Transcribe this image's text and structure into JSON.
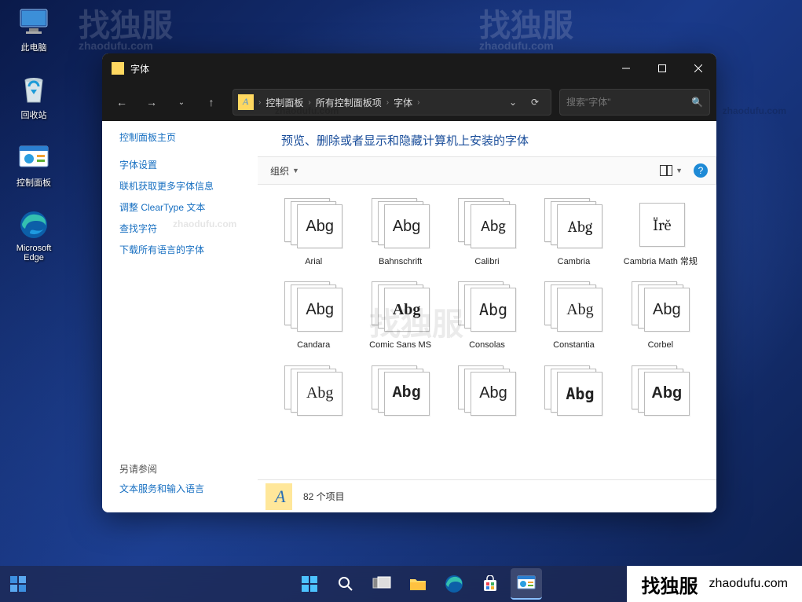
{
  "desktop": {
    "icons": [
      {
        "id": "this-pc",
        "label": "此电脑"
      },
      {
        "id": "recycle-bin",
        "label": "回收站"
      },
      {
        "id": "control-panel",
        "label": "控制面板"
      },
      {
        "id": "edge",
        "label": "Microsoft Edge"
      }
    ]
  },
  "window": {
    "title": "字体",
    "breadcrumbs": [
      "控制面板",
      "所有控制面板项",
      "字体"
    ],
    "search_placeholder": "搜索\"字体\"",
    "nav_dropdown_glyph": "⌄",
    "refresh_glyph": "⟳"
  },
  "sidebar": {
    "home": "控制面板主页",
    "links": [
      "字体设置",
      "联机获取更多字体信息",
      "调整 ClearType 文本",
      "查找字符",
      "下载所有语言的字体"
    ],
    "see_also_head": "另请参阅",
    "see_also": [
      "文本服务和输入语言"
    ]
  },
  "page": {
    "heading": "预览、删除或者显示和隐藏计算机上安装的字体",
    "toolbar": {
      "organize": "组织"
    },
    "status": {
      "count": "82 个项目"
    }
  },
  "fonts": [
    {
      "name": "Arial",
      "sample": "Abg",
      "multi": true,
      "family": "Arial,sans-serif"
    },
    {
      "name": "Bahnschrift",
      "sample": "Abg",
      "multi": true,
      "family": "Bahnschrift,Arial Narrow,sans-serif"
    },
    {
      "name": "Calibri",
      "sample": "Abg",
      "multi": true,
      "family": "Calibri,sans-serif"
    },
    {
      "name": "Cambria",
      "sample": "Abg",
      "multi": true,
      "family": "Cambria,serif"
    },
    {
      "name": "Cambria Math 常规",
      "sample": "Ïrĕ",
      "multi": false,
      "family": "Cambria Math,Cambria,serif"
    },
    {
      "name": "Candara",
      "sample": "Abg",
      "multi": true,
      "family": "Candara,sans-serif"
    },
    {
      "name": "Comic Sans MS",
      "sample": "Abg",
      "multi": true,
      "family": "Comic Sans MS,cursive",
      "bold": true
    },
    {
      "name": "Consolas",
      "sample": "Abg",
      "multi": true,
      "family": "Consolas,monospace"
    },
    {
      "name": "Constantia",
      "sample": "Abg",
      "multi": true,
      "family": "Constantia,serif"
    },
    {
      "name": "Corbel",
      "sample": "Abg",
      "multi": true,
      "family": "Corbel,sans-serif"
    },
    {
      "name": "",
      "sample": "Abg",
      "multi": true,
      "family": "Georgia,serif"
    },
    {
      "name": "",
      "sample": "Abg",
      "multi": true,
      "family": "Courier New,monospace",
      "bold": true
    },
    {
      "name": "",
      "sample": "Abg",
      "multi": true,
      "family": "sans-serif"
    },
    {
      "name": "",
      "sample": "Abg",
      "multi": true,
      "family": "monospace",
      "bold": true
    },
    {
      "name": "",
      "sample": "Abg",
      "multi": true,
      "family": "Arial Black,sans-serif",
      "bold": true
    }
  ],
  "watermark": {
    "zh": "找独服",
    "en": "zhaodufu.com"
  },
  "taskbar_right": {
    "zh": "找独服",
    "en": "zhaodufu.com"
  }
}
